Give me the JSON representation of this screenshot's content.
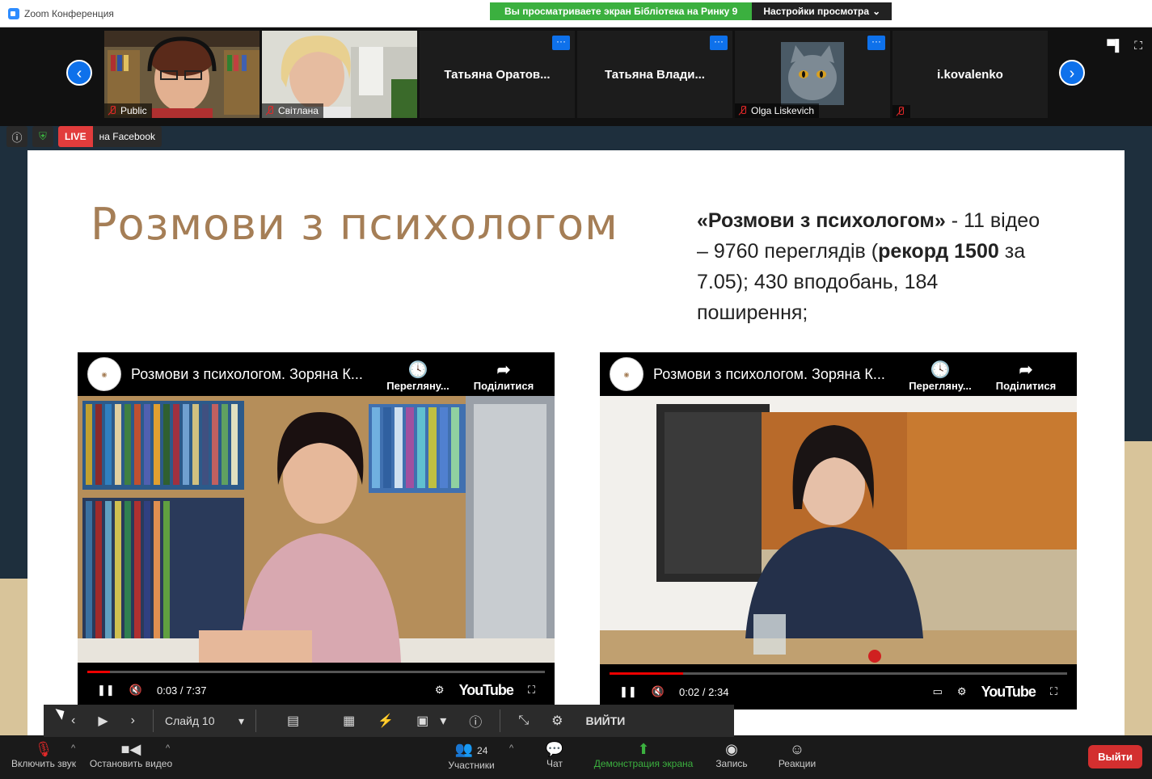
{
  "window": {
    "title": "Zoom Конференция"
  },
  "banner": {
    "viewing": "Вы просматриваете экран Бібліотека на Ринку 9",
    "view_settings": "Настройки просмотра"
  },
  "participants": [
    {
      "name": "Public",
      "type": "video"
    },
    {
      "name": "Світлана",
      "type": "video"
    },
    {
      "name": "Татьяна  Оратов...",
      "type": "name"
    },
    {
      "name": "Татьяна  Влади...",
      "type": "name"
    },
    {
      "name": "Olga Liskevich",
      "type": "avatar"
    },
    {
      "name": "i.kovalenko",
      "type": "name"
    }
  ],
  "status": {
    "live_tag": "LIVE",
    "live_target": "на Facebook"
  },
  "slide": {
    "title": "Розмови з психологом",
    "text_bold1": "«Розмови з психологом»",
    "text1": " - 11 відео – 9760 переглядів (",
    "text_bold2": "рекорд 1500",
    "text2": " за 7.05); 430 вподобань, 184 поширення;"
  },
  "videos": [
    {
      "title": "Розмови з психологом. Зоряна К...",
      "watch_later": "Перегляну...",
      "share": "Поділитися",
      "time": "0:03 / 7:37",
      "progress": 0.05,
      "brand": "YouTube"
    },
    {
      "title": "Розмови з психологом. Зоряна К...",
      "watch_later": "Перегляну...",
      "share": "Поділитися",
      "time": "0:02 / 2:34",
      "progress": 0.16,
      "brand": "YouTube"
    }
  ],
  "presenter_bar": {
    "slide_label": "Слайд 10",
    "exit": "ВИЙТИ"
  },
  "toolbar": {
    "unmute": "Включить звук",
    "stop_video": "Остановить видео",
    "participants": "Участники",
    "participants_count": "24",
    "chat": "Чат",
    "share_screen": "Демонстрация экрана",
    "record": "Запись",
    "reactions": "Реакции",
    "leave": "Выйти"
  },
  "colors": {
    "accent": "#0e71eb",
    "live": "#e23c3c",
    "share": "#3bb03f",
    "title": "#a57e56",
    "leave": "#d32f2f"
  }
}
